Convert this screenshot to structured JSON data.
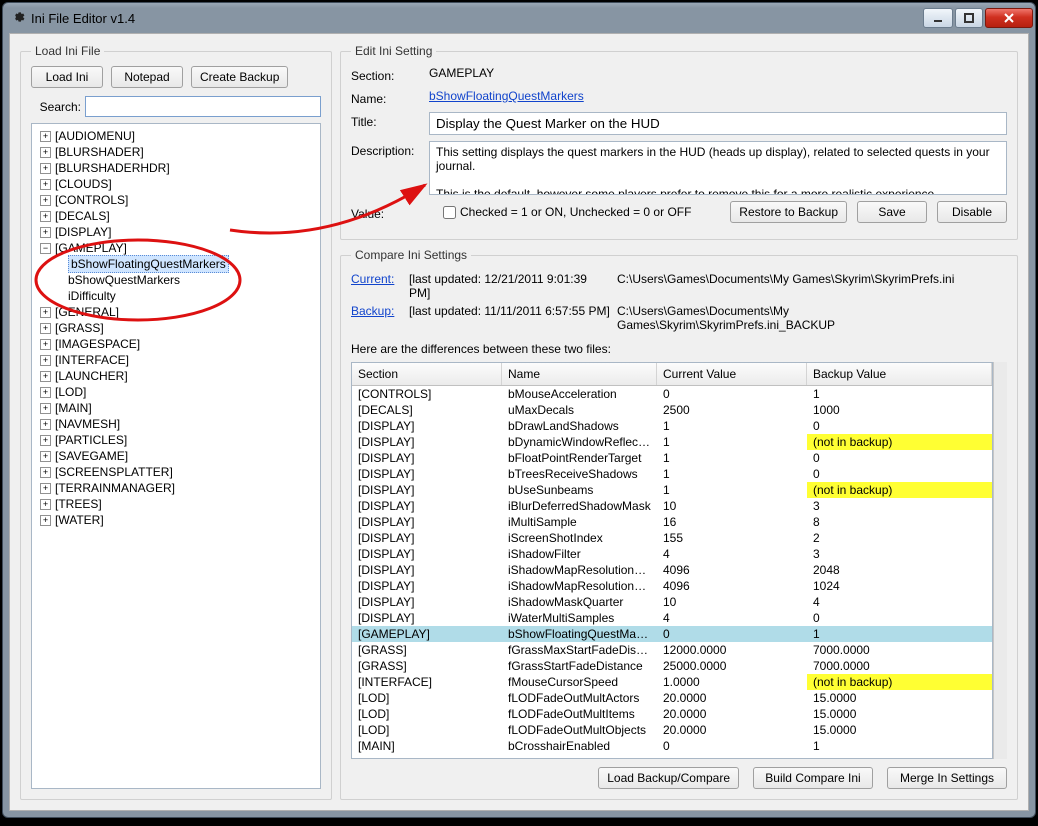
{
  "window": {
    "title": "Ini File Editor v1.4"
  },
  "leftPanel": {
    "legend": "Load Ini File",
    "buttons": {
      "load": "Load Ini",
      "notepad": "Notepad",
      "backup": "Create Backup"
    },
    "searchLabel": "Search:",
    "tree": [
      {
        "label": "[AUDIOMENU]",
        "level": 1,
        "expandable": true,
        "expanded": false
      },
      {
        "label": "[BLURSHADER]",
        "level": 1,
        "expandable": true,
        "expanded": false
      },
      {
        "label": "[BLURSHADERHDR]",
        "level": 1,
        "expandable": true,
        "expanded": false
      },
      {
        "label": "[CLOUDS]",
        "level": 1,
        "expandable": true,
        "expanded": false
      },
      {
        "label": "[CONTROLS]",
        "level": 1,
        "expandable": true,
        "expanded": false
      },
      {
        "label": "[DECALS]",
        "level": 1,
        "expandable": true,
        "expanded": false
      },
      {
        "label": "[DISPLAY]",
        "level": 1,
        "expandable": true,
        "expanded": false
      },
      {
        "label": "[GAMEPLAY]",
        "level": 1,
        "expandable": true,
        "expanded": true
      },
      {
        "label": "bShowFloatingQuestMarkers",
        "level": 2,
        "selected": true
      },
      {
        "label": "bShowQuestMarkers",
        "level": 2
      },
      {
        "label": "iDifficulty",
        "level": 2
      },
      {
        "label": "[GENERAL]",
        "level": 1,
        "expandable": true,
        "expanded": false
      },
      {
        "label": "[GRASS]",
        "level": 1,
        "expandable": true,
        "expanded": false
      },
      {
        "label": "[IMAGESPACE]",
        "level": 1,
        "expandable": true,
        "expanded": false
      },
      {
        "label": "[INTERFACE]",
        "level": 1,
        "expandable": true,
        "expanded": false
      },
      {
        "label": "[LAUNCHER]",
        "level": 1,
        "expandable": true,
        "expanded": false
      },
      {
        "label": "[LOD]",
        "level": 1,
        "expandable": true,
        "expanded": false
      },
      {
        "label": "[MAIN]",
        "level": 1,
        "expandable": true,
        "expanded": false
      },
      {
        "label": "[NAVMESH]",
        "level": 1,
        "expandable": true,
        "expanded": false
      },
      {
        "label": "[PARTICLES]",
        "level": 1,
        "expandable": true,
        "expanded": false
      },
      {
        "label": "[SAVEGAME]",
        "level": 1,
        "expandable": true,
        "expanded": false
      },
      {
        "label": "[SCREENSPLATTER]",
        "level": 1,
        "expandable": true,
        "expanded": false
      },
      {
        "label": "[TERRAINMANAGER]",
        "level": 1,
        "expandable": true,
        "expanded": false
      },
      {
        "label": "[TREES]",
        "level": 1,
        "expandable": true,
        "expanded": false
      },
      {
        "label": "[WATER]",
        "level": 1,
        "expandable": true,
        "expanded": false
      }
    ]
  },
  "editPanel": {
    "legend": "Edit Ini Setting",
    "labels": {
      "section": "Section:",
      "name": "Name:",
      "title": "Title:",
      "description": "Description:",
      "value": "Value:"
    },
    "section": "GAMEPLAY",
    "name": "bShowFloatingQuestMarkers",
    "title": "Display the Quest Marker on the HUD",
    "description": "This setting displays the quest markers in the HUD (heads up display), related to selected quests in your journal.\n\nThis is the default, however some players prefer to remove this for a more realistic experience.",
    "checkboxLabel": "Checked = 1 or ON, Unchecked = 0 or OFF",
    "buttons": {
      "restore": "Restore to Backup",
      "save": "Save",
      "disable": "Disable"
    }
  },
  "comparePanel": {
    "legend": "Compare Ini Settings",
    "currentLabel": "Current:",
    "currentUpdated": "[last updated: 12/21/2011 9:01:39 PM]",
    "currentPath": "C:\\Users\\Games\\Documents\\My Games\\Skyrim\\SkyrimPrefs.ini",
    "backupLabel": "Backup:",
    "backupUpdated": "[last updated: 11/11/2011 6:57:55 PM]",
    "backupPath": "C:\\Users\\Games\\Documents\\My Games\\Skyrim\\SkyrimPrefs.ini_BACKUP",
    "diffNote": "Here are the differences between these two files:",
    "columns": [
      "Section",
      "Name",
      "Current Value",
      "Backup Value"
    ],
    "rows": [
      {
        "s": "[CONTROLS]",
        "n": "bMouseAcceleration",
        "c": "0",
        "b": "1"
      },
      {
        "s": "[DECALS]",
        "n": "uMaxDecals",
        "c": "2500",
        "b": "1000"
      },
      {
        "s": "[DISPLAY]",
        "n": "bDrawLandShadows",
        "c": "1",
        "b": "0"
      },
      {
        "s": "[DISPLAY]",
        "n": "bDynamicWindowReflections",
        "c": "1",
        "b": "(not in backup)",
        "bYellow": true
      },
      {
        "s": "[DISPLAY]",
        "n": "bFloatPointRenderTarget",
        "c": "1",
        "b": "0"
      },
      {
        "s": "[DISPLAY]",
        "n": "bTreesReceiveShadows",
        "c": "1",
        "b": "0"
      },
      {
        "s": "[DISPLAY]",
        "n": "bUseSunbeams",
        "c": "1",
        "b": "(not in backup)",
        "bYellow": true
      },
      {
        "s": "[DISPLAY]",
        "n": "iBlurDeferredShadowMask",
        "c": "10",
        "b": "3"
      },
      {
        "s": "[DISPLAY]",
        "n": "iMultiSample",
        "c": "16",
        "b": "8"
      },
      {
        "s": "[DISPLAY]",
        "n": "iScreenShotIndex",
        "c": "155",
        "b": "2"
      },
      {
        "s": "[DISPLAY]",
        "n": "iShadowFilter",
        "c": "4",
        "b": "3"
      },
      {
        "s": "[DISPLAY]",
        "n": "iShadowMapResolutionPrim…",
        "c": "4096",
        "b": "2048"
      },
      {
        "s": "[DISPLAY]",
        "n": "iShadowMapResolutionSec…",
        "c": "4096",
        "b": "1024"
      },
      {
        "s": "[DISPLAY]",
        "n": "iShadowMaskQuarter",
        "c": "10",
        "b": "4"
      },
      {
        "s": "[DISPLAY]",
        "n": "iWaterMultiSamples",
        "c": "4",
        "b": "0"
      },
      {
        "s": "[GAMEPLAY]",
        "n": "bShowFloatingQuestMarkers",
        "c": "0",
        "b": "1",
        "hl": true
      },
      {
        "s": "[GRASS]",
        "n": "fGrassMaxStartFadeDistance",
        "c": "12000.0000",
        "b": "7000.0000"
      },
      {
        "s": "[GRASS]",
        "n": "fGrassStartFadeDistance",
        "c": "25000.0000",
        "b": "7000.0000"
      },
      {
        "s": "[INTERFACE]",
        "n": "fMouseCursorSpeed",
        "c": "1.0000",
        "b": "(not in backup)",
        "bYellow": true
      },
      {
        "s": "[LOD]",
        "n": "fLODFadeOutMultActors",
        "c": "20.0000",
        "b": "15.0000"
      },
      {
        "s": "[LOD]",
        "n": "fLODFadeOutMultItems",
        "c": "20.0000",
        "b": "15.0000"
      },
      {
        "s": "[LOD]",
        "n": "fLODFadeOutMultObjects",
        "c": "20.0000",
        "b": "15.0000"
      },
      {
        "s": "[MAIN]",
        "n": "bCrosshairEnabled",
        "c": "0",
        "b": "1"
      }
    ],
    "buttons": {
      "loadCompare": "Load Backup/Compare",
      "build": "Build Compare Ini",
      "merge": "Merge In Settings"
    }
  }
}
